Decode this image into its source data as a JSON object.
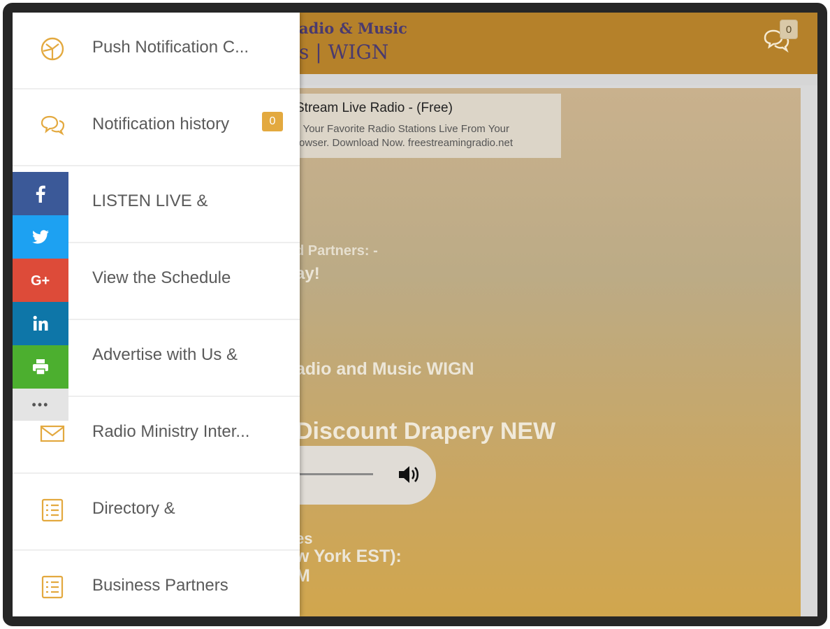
{
  "header": {
    "title_line1": "adio & Music",
    "title_line2": "s | WIGN",
    "chat_badge": "0",
    "icon": "chat-bubbles-icon"
  },
  "ad": {
    "title": "Stream Live Radio - (Free)",
    "line1": "ll Your Favorite Radio Stations Live From Your",
    "line2": "rowser. Download Now. freestreamingradio.net"
  },
  "background_text": {
    "partners": "d Partners: -",
    "today": "ay!",
    "station": "adio and Music WIGN",
    "discount": "Discount Drapery NEW",
    "times": "es",
    "timezone": "w York EST):",
    "pm": "M"
  },
  "player": {
    "icon": "volume-icon"
  },
  "drawer": {
    "items": [
      {
        "label": "Push Notification C...",
        "icon": "globe-icon"
      },
      {
        "label": "Notification history",
        "icon": "chat-bubbles-icon",
        "badge": "0"
      },
      {
        "label": "LISTEN LIVE &",
        "icon": "radio-icon"
      },
      {
        "label": "View the Schedule",
        "icon": "calendar-icon"
      },
      {
        "label": "Advertise with Us &",
        "icon": "megaphone-icon"
      },
      {
        "label": "Radio Ministry Inter...",
        "icon": "envelope-icon"
      },
      {
        "label": "Directory &",
        "icon": "list-icon"
      },
      {
        "label": "Business Partners",
        "icon": "list-icon"
      }
    ]
  },
  "share": {
    "buttons": [
      "facebook",
      "twitter",
      "google-plus",
      "linkedin",
      "print",
      "more"
    ],
    "more_label": "•••"
  },
  "colors": {
    "accent": "#e3a93f",
    "header": "#b5812a",
    "facebook": "#3b5998",
    "twitter": "#1da1f2",
    "google_plus": "#dd4b39",
    "linkedin": "#0e76a8",
    "print": "#4caf2f"
  }
}
